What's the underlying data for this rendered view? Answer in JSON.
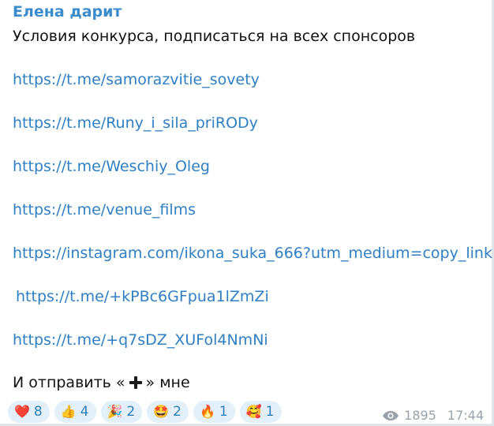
{
  "message": {
    "sender": "Елена дарит",
    "intro": "Условия конкурса, подписаться на всех спонсоров",
    "links": [
      "https://t.me/samorazvitie_sovety",
      "https://t.me/Runy_i_sila_priRODy",
      "https://t.me/Weschiy_Oleg",
      "https://t.me/venue_films",
      "https://instagram.com/ikona_suka_666?utm_medium=copy_link",
      "https://t.me/+kPBc6GFpua1lZmZi",
      "https://t.me/+q7sDZ_XUFol4NmNi"
    ],
    "outro_before": "И отправить «",
    "outro_icon": "heavy-plus-icon",
    "outro_after": "» мне"
  },
  "reactions": [
    {
      "emoji": "❤️",
      "icon": "red-heart-icon",
      "count": "8"
    },
    {
      "emoji": "👍",
      "icon": "thumbs-up-icon",
      "count": "4"
    },
    {
      "emoji": "🎉",
      "icon": "party-popper-icon",
      "count": "2"
    },
    {
      "emoji": "🤩",
      "icon": "star-struck-icon",
      "count": "2"
    },
    {
      "emoji": "🔥",
      "icon": "fire-icon",
      "count": "1"
    },
    {
      "emoji": "🥰",
      "icon": "smiling-face-with-hearts-icon",
      "count": "1"
    }
  ],
  "meta": {
    "views": "1895",
    "time": "17:44",
    "views_icon": "eye-icon"
  },
  "colors": {
    "sender": "#3a8ccd",
    "link": "#2f7fc4",
    "reaction_bg": "#e3f0fa",
    "reaction_text": "#2e7fc0",
    "meta": "#9aa3ab"
  }
}
